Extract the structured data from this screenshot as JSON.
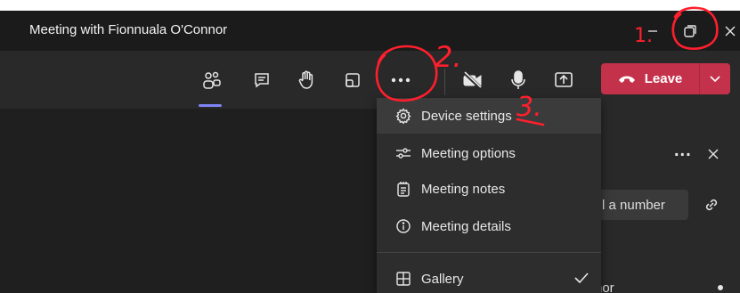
{
  "window": {
    "title": "Meeting with Fionnuala O'Connor"
  },
  "titlebar_controls": [
    "minimize-icon",
    "restore-icon",
    "close-icon"
  ],
  "toolbar": {
    "buttons": [
      "people-icon",
      "chat-icon",
      "raise-hand-icon",
      "breakout-rooms-icon",
      "more-actions-icon",
      "camera-off-icon",
      "mic-icon",
      "share-screen-icon"
    ],
    "leave_label": "Leave"
  },
  "menu": {
    "items": [
      {
        "label": "Device settings",
        "icon": "gear-icon"
      },
      {
        "label": "Meeting options",
        "icon": "sliders-icon"
      },
      {
        "label": "Meeting notes",
        "icon": "notes-icon"
      },
      {
        "label": "Meeting details",
        "icon": "info-icon"
      },
      {
        "label": "Gallery",
        "icon": "grid-icon",
        "checked": true
      }
    ]
  },
  "side_panel": {
    "more_label": "...",
    "dial_text": "l a number",
    "bottom_text": "nor"
  },
  "annotations": {
    "labels": [
      "1.",
      "2.",
      "3."
    ],
    "color": "#ff1f2d"
  },
  "colors": {
    "leave": "#c4314b",
    "accent": "#7f85f5",
    "annotation": "#ff1f2d"
  }
}
